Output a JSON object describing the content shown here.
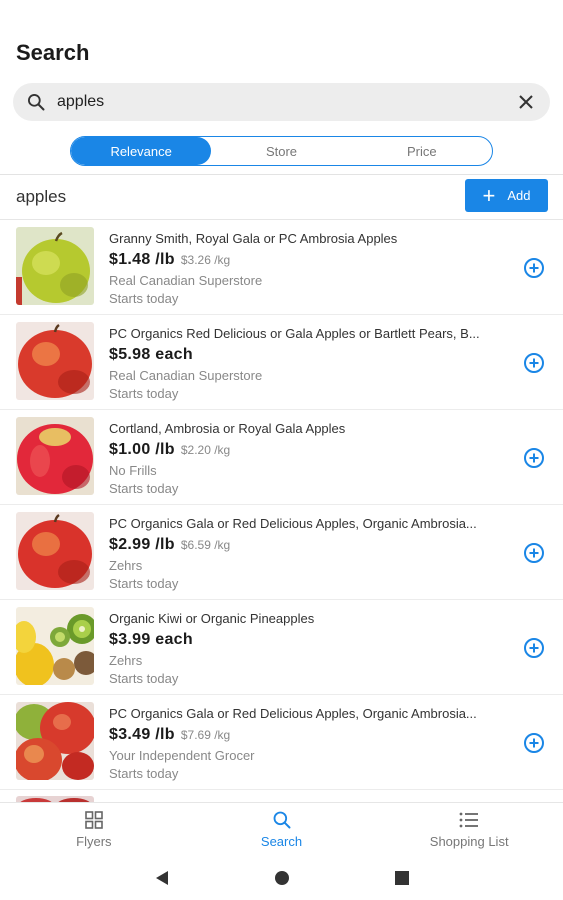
{
  "header": {
    "title": "Search"
  },
  "search": {
    "value": "apples",
    "search_icon": "search-icon",
    "clear_icon": "close-icon"
  },
  "sort_tabs": [
    {
      "label": "Relevance",
      "active": true
    },
    {
      "label": "Store",
      "active": false
    },
    {
      "label": "Price",
      "active": false
    }
  ],
  "query_row": {
    "label": "apples",
    "add_label": "Add"
  },
  "results": [
    {
      "name": "Granny Smith, Royal Gala or PC Ambrosia Apples",
      "price": "$1.48 /lb",
      "unit_price": "$3.26 /kg",
      "store": "Real Canadian Superstore",
      "starts": "Starts today",
      "image": "green-apple"
    },
    {
      "name": "PC Organics Red Delicious or Gala Apples or Bartlett Pears, B...",
      "price": "$5.98 each",
      "unit_price": "",
      "store": "Real Canadian Superstore",
      "starts": "Starts today",
      "image": "red-apple"
    },
    {
      "name": "Cortland, Ambrosia or Royal Gala Apples",
      "price": "$1.00 /lb",
      "unit_price": "$2.20 /kg",
      "store": "No Frills",
      "starts": "Starts today",
      "image": "red-apple"
    },
    {
      "name": "PC Organics Gala or Red Delicious Apples, Organic Ambrosia...",
      "price": "$2.99 /lb",
      "unit_price": "$6.59 /kg",
      "store": "Zehrs",
      "starts": "Starts today",
      "image": "red-apple"
    },
    {
      "name": "Organic Kiwi or Organic Pineapples",
      "price": "$3.99 each",
      "unit_price": "",
      "store": "Zehrs",
      "starts": "Starts today",
      "image": "kiwi-pineapple"
    },
    {
      "name": "PC Organics Gala or Red Delicious Apples, Organic Ambrosia...",
      "price": "$3.49 /lb",
      "unit_price": "$7.69 /kg",
      "store": "Your Independent Grocer",
      "starts": "Starts today",
      "image": "apples-pile"
    }
  ],
  "bottom_nav": [
    {
      "label": "Flyers",
      "icon": "grid-icon",
      "active": false
    },
    {
      "label": "Search",
      "icon": "search-icon",
      "active": true
    },
    {
      "label": "Shopping List",
      "icon": "list-icon",
      "active": false
    }
  ],
  "system_nav": {
    "back": "back-icon",
    "home": "home-icon",
    "recents": "recents-icon"
  },
  "colors": {
    "accent": "#1a86e6",
    "search_bg": "#ededed",
    "secondary_text": "#888888"
  }
}
